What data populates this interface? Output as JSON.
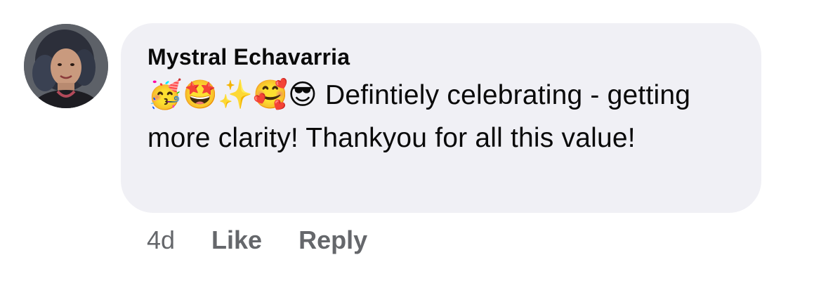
{
  "comment": {
    "author": "Mystral Echavarria",
    "emojis": "🥳🤩✨🥰😎",
    "text": "Defintiely celebrating - getting more clarity! Thankyou for all this value!",
    "timestamp": "4d",
    "like_label": "Like",
    "reply_label": "Reply"
  },
  "colors": {
    "bubble_bg": "#f0f0f5",
    "meta_text": "#65676b",
    "text": "#0a0a0a"
  }
}
